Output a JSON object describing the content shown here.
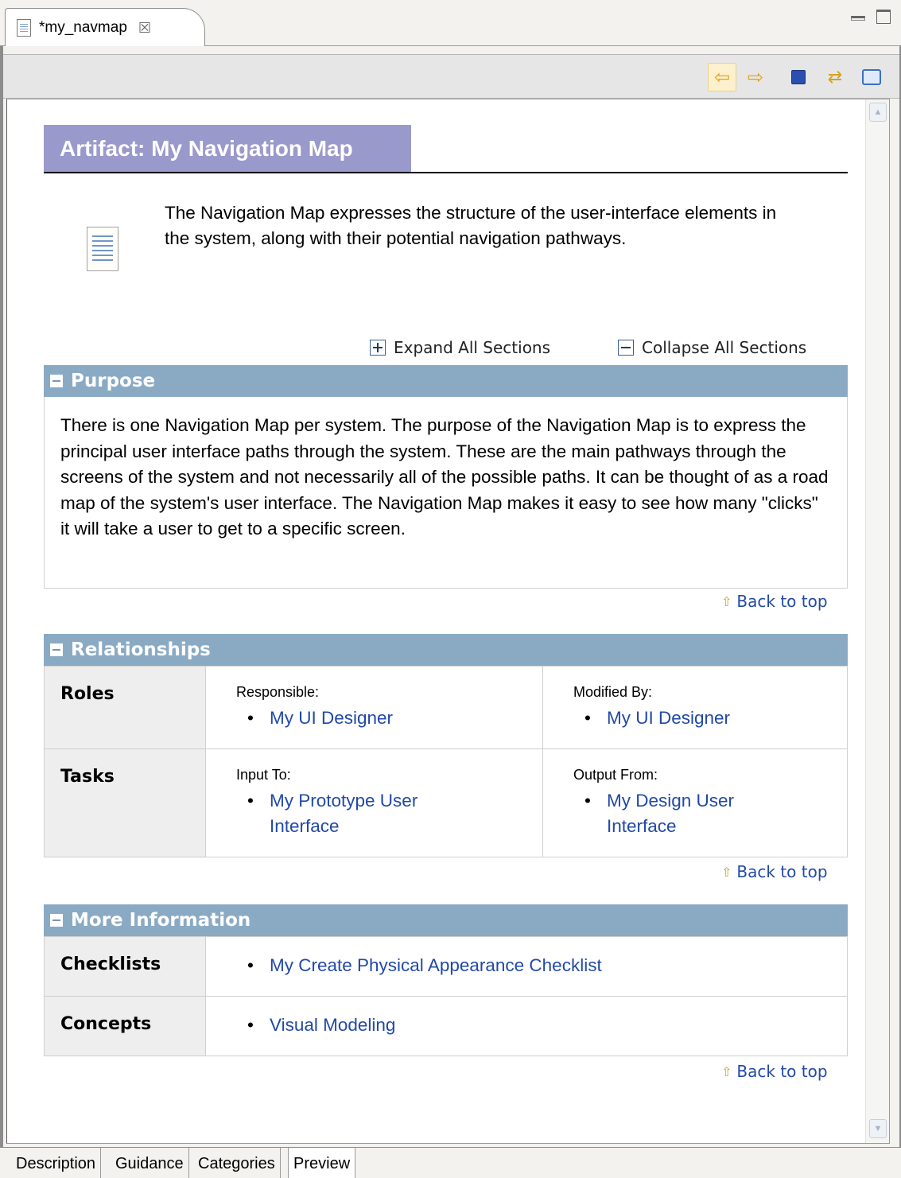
{
  "editor_tab": {
    "title": "*my_navmap",
    "close": "☒"
  },
  "toolbar": {
    "back": "⇦",
    "forward": "⇨",
    "refresh": "⇄"
  },
  "page": {
    "title": "Artifact: My Navigation Map",
    "intro": "The Navigation Map expresses the structure of the user-interface elements in the system, along with their potential navigation pathways.",
    "expand_all": "Expand All Sections",
    "collapse_all": "Collapse All Sections",
    "back_to_top": "Back to top"
  },
  "purpose": {
    "heading": "Purpose",
    "body": "There is one Navigation Map per system. The purpose of the Navigation Map is to express the principal user interface paths through the system. These are the main pathways through the screens of the system and not necessarily all of the possible paths. It can be thought of as a road map of the system's user interface. The Navigation Map makes it easy to see how many \"clicks\" it will take a user to get to a specific screen."
  },
  "relationships": {
    "heading": "Relationships",
    "roles": {
      "label": "Roles",
      "responsible_label": "Responsible:",
      "responsible": "My UI Designer",
      "modified_label": "Modified By:",
      "modified": "My UI Designer"
    },
    "tasks": {
      "label": "Tasks",
      "input_label": "Input To:",
      "input": "My Prototype User Interface",
      "output_label": "Output From:",
      "output": "My Design User Interface"
    }
  },
  "more_info": {
    "heading": "More Information",
    "checklists_label": "Checklists",
    "checklist": "My Create Physical Appearance Checklist",
    "concepts_label": "Concepts",
    "concept": "Visual Modeling"
  },
  "bottom_tabs": [
    "Description",
    "Guidance",
    "Categories",
    "Preview"
  ]
}
